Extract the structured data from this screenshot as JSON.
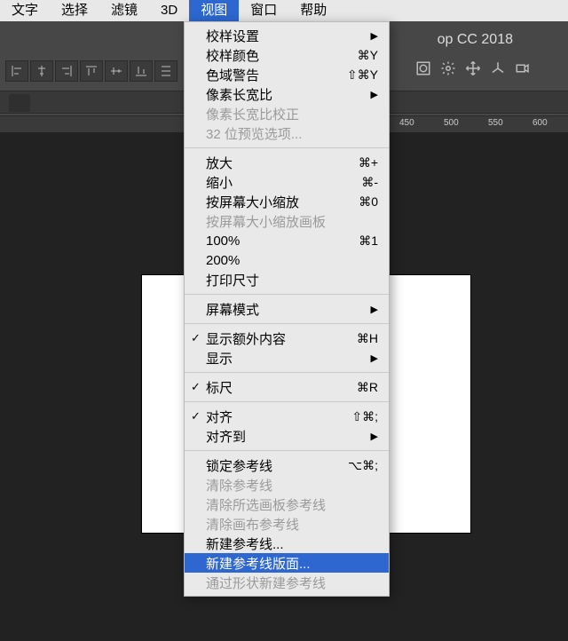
{
  "menubar": {
    "items": [
      {
        "label": "文字"
      },
      {
        "label": "选择"
      },
      {
        "label": "滤镜"
      },
      {
        "label": "3D"
      },
      {
        "label": "视图",
        "active": true
      },
      {
        "label": "窗口"
      },
      {
        "label": "帮助"
      }
    ]
  },
  "app_title_fragment": "op CC 2018",
  "ruler_marks": [
    "450",
    "500",
    "550",
    "600"
  ],
  "dropdown": {
    "sections": [
      [
        {
          "label": "校样设置",
          "submenu": true
        },
        {
          "label": "校样颜色",
          "shortcut": "⌘Y"
        },
        {
          "label": "色域警告",
          "shortcut": "⇧⌘Y"
        },
        {
          "label": "像素长宽比",
          "submenu": true
        },
        {
          "label": "像素长宽比校正",
          "disabled": true
        },
        {
          "label": "32 位预览选项...",
          "disabled": true
        }
      ],
      [
        {
          "label": "放大",
          "shortcut": "⌘+"
        },
        {
          "label": "缩小",
          "shortcut": "⌘-"
        },
        {
          "label": "按屏幕大小缩放",
          "shortcut": "⌘0"
        },
        {
          "label": "按屏幕大小缩放画板",
          "disabled": true
        },
        {
          "label": "100%",
          "shortcut": "⌘1"
        },
        {
          "label": "200%"
        },
        {
          "label": "打印尺寸"
        }
      ],
      [
        {
          "label": "屏幕模式",
          "submenu": true
        }
      ],
      [
        {
          "label": "显示额外内容",
          "checked": true,
          "shortcut": "⌘H"
        },
        {
          "label": "显示",
          "submenu": true
        }
      ],
      [
        {
          "label": "标尺",
          "checked": true,
          "shortcut": "⌘R"
        }
      ],
      [
        {
          "label": "对齐",
          "checked": true,
          "shortcut": "⇧⌘;"
        },
        {
          "label": "对齐到",
          "submenu": true
        }
      ],
      [
        {
          "label": "锁定参考线",
          "shortcut": "⌥⌘;"
        },
        {
          "label": "清除参考线",
          "disabled": true
        },
        {
          "label": "清除所选画板参考线",
          "disabled": true
        },
        {
          "label": "清除画布参考线",
          "disabled": true
        },
        {
          "label": "新建参考线..."
        },
        {
          "label": "新建参考线版面...",
          "highlight": true
        },
        {
          "label": "通过形状新建参考线",
          "disabled": true
        }
      ]
    ]
  }
}
